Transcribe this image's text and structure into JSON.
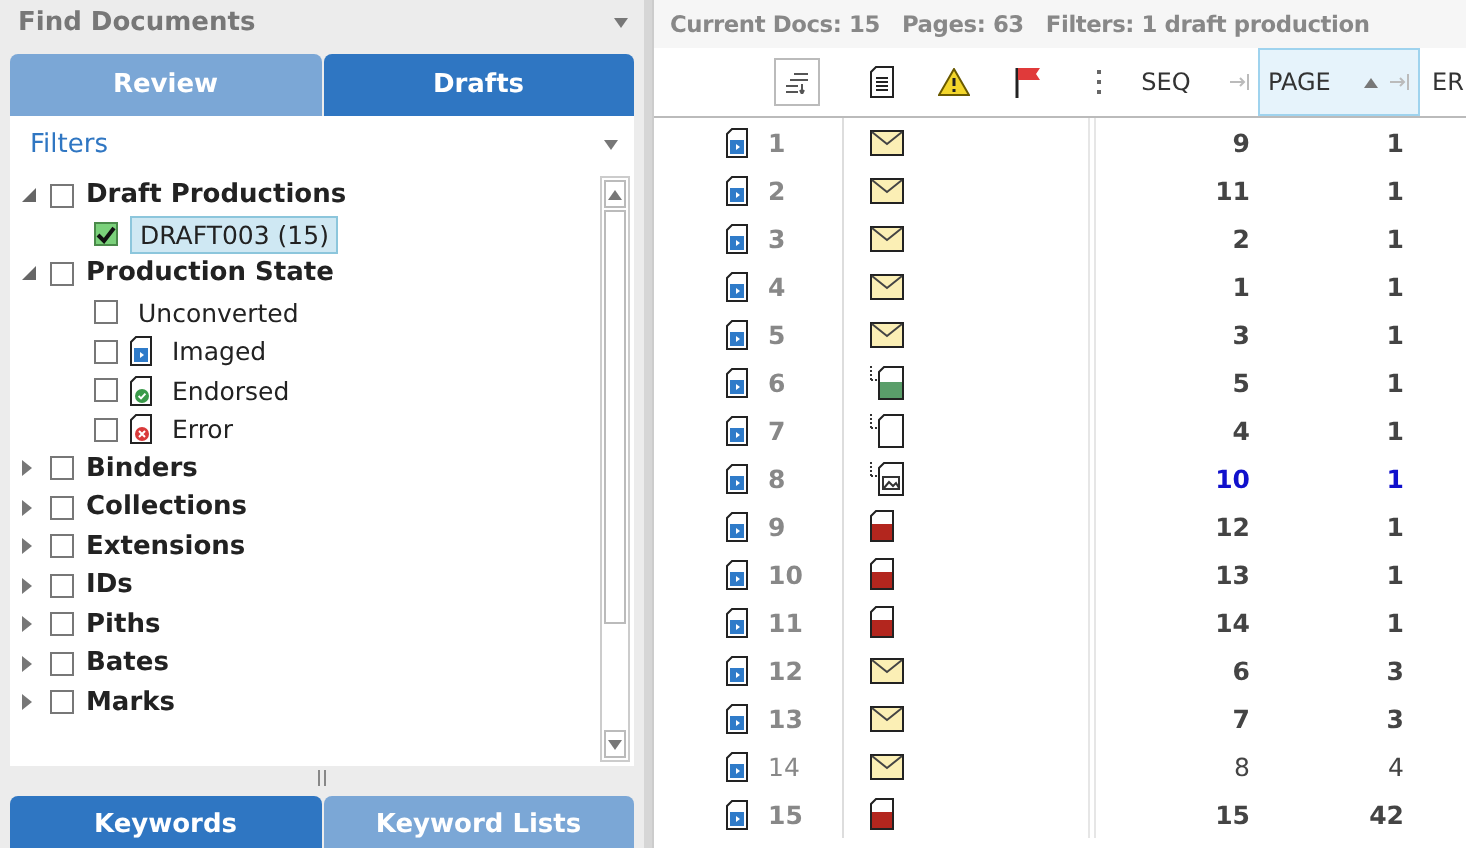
{
  "panel": {
    "title": "Find Documents"
  },
  "tabs": [
    {
      "label": "Review",
      "selected": false
    },
    {
      "label": "Drafts",
      "selected": true
    }
  ],
  "filters": {
    "title": "Filters"
  },
  "tree": [
    {
      "label": "Draft Productions",
      "expanded": true,
      "checked": false,
      "children": [
        {
          "label": "DRAFT003 (15)",
          "checked": true,
          "selected": true
        }
      ]
    },
    {
      "label": "Production State",
      "expanded": true,
      "checked": false,
      "children": [
        {
          "label": "Unconverted",
          "checked": false,
          "selected": false
        },
        {
          "label": "Imaged",
          "checked": false,
          "selected": false,
          "kind": "imaged"
        },
        {
          "label": "Endorsed",
          "checked": false,
          "selected": false,
          "kind": "endorsed"
        },
        {
          "label": "Error",
          "checked": false,
          "selected": false,
          "kind": "error"
        }
      ]
    },
    {
      "label": "Binders",
      "expanded": false,
      "checked": false
    },
    {
      "label": "Collections",
      "expanded": false,
      "checked": false
    },
    {
      "label": "Extensions",
      "expanded": false,
      "checked": false
    },
    {
      "label": "IDs",
      "expanded": false,
      "checked": false
    },
    {
      "label": "Piths",
      "expanded": false,
      "checked": false
    },
    {
      "label": "Bates",
      "expanded": false,
      "checked": false
    },
    {
      "label": "Marks",
      "expanded": false,
      "checked": false
    }
  ],
  "bottom_tabs": [
    {
      "label": "Keywords",
      "selected": true
    },
    {
      "label": "Keyword Lists",
      "selected": false
    }
  ],
  "summary": [
    "Current Docs: 15",
    "Pages: 63",
    "Filters: 1 draft production"
  ],
  "table": {
    "columns": [
      {
        "label": "SEQ",
        "sorted": false
      },
      {
        "label": "PAGE",
        "sorted": true
      },
      {
        "label": "ER",
        "sorted": false
      }
    ],
    "rows": [
      {
        "number": "1",
        "kind": "email",
        "seq": "9",
        "pages": "1",
        "bold": true,
        "current": false
      },
      {
        "number": "2",
        "kind": "email",
        "seq": "11",
        "pages": "1",
        "bold": true,
        "current": false
      },
      {
        "number": "3",
        "kind": "email",
        "seq": "2",
        "pages": "1",
        "bold": true,
        "current": false
      },
      {
        "number": "4",
        "kind": "email",
        "seq": "1",
        "pages": "1",
        "bold": true,
        "current": false
      },
      {
        "number": "5",
        "kind": "email",
        "seq": "3",
        "pages": "1",
        "bold": true,
        "current": false
      },
      {
        "number": "6",
        "kind": "attachment-green",
        "seq": "5",
        "pages": "1",
        "bold": true,
        "current": false
      },
      {
        "number": "7",
        "kind": "attachment",
        "seq": "4",
        "pages": "1",
        "bold": true,
        "current": false
      },
      {
        "number": "8",
        "kind": "attachment-image",
        "seq": "10",
        "pages": "1",
        "bold": true,
        "current": true
      },
      {
        "number": "9",
        "kind": "red-doc",
        "seq": "12",
        "pages": "1",
        "bold": true,
        "current": false
      },
      {
        "number": "10",
        "kind": "red-doc",
        "seq": "13",
        "pages": "1",
        "bold": true,
        "current": false
      },
      {
        "number": "11",
        "kind": "red-doc",
        "seq": "14",
        "pages": "1",
        "bold": true,
        "current": false
      },
      {
        "number": "12",
        "kind": "email",
        "seq": "6",
        "pages": "3",
        "bold": true,
        "current": false
      },
      {
        "number": "13",
        "kind": "email",
        "seq": "7",
        "pages": "3",
        "bold": true,
        "current": false
      },
      {
        "number": "14",
        "kind": "email",
        "seq": "8",
        "pages": "4",
        "bold": false,
        "current": false
      },
      {
        "number": "15",
        "kind": "red-doc",
        "seq": "15",
        "pages": "42",
        "bold": true,
        "current": false
      }
    ]
  }
}
